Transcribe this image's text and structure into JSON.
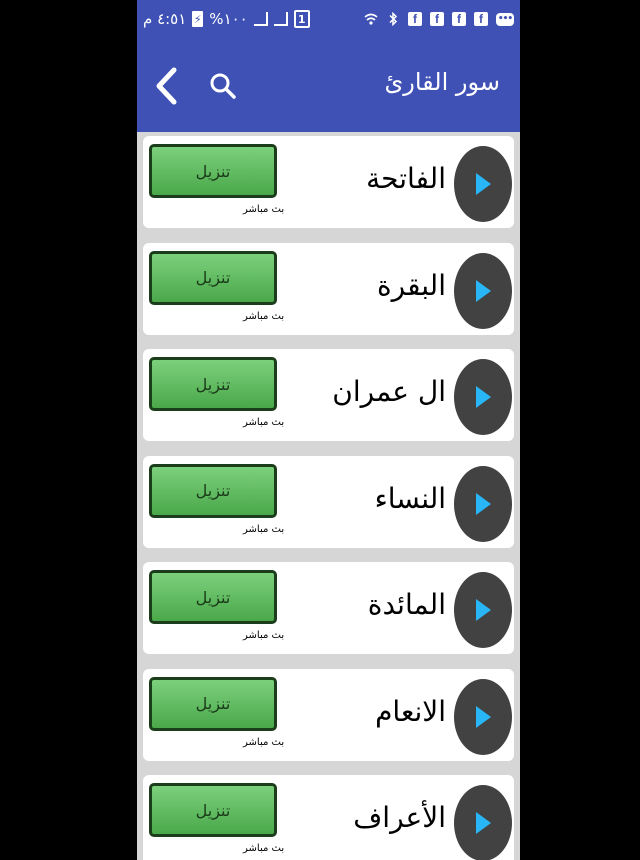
{
  "status_bar": {
    "time": "٤:٥١ م",
    "battery": "%١٠٠",
    "sim_label": "1"
  },
  "app_bar": {
    "title": "سور القارئ"
  },
  "colors": {
    "primary": "#3f51b5",
    "play_icon": "#29b6f6",
    "download_green": "#5cb85c",
    "play_circle": "#424242"
  },
  "surahs": [
    {
      "name": "الفاتحة",
      "download_label": "تنزيل",
      "live_label": "بث مباشر"
    },
    {
      "name": "البقرة",
      "download_label": "تنزيل",
      "live_label": "بث مباشر"
    },
    {
      "name": "ال عمران",
      "download_label": "تنزيل",
      "live_label": "بث مباشر"
    },
    {
      "name": "النساء",
      "download_label": "تنزيل",
      "live_label": "بث مباشر"
    },
    {
      "name": "المائدة",
      "download_label": "تنزيل",
      "live_label": "بث مباشر"
    },
    {
      "name": "الانعام",
      "download_label": "تنزيل",
      "live_label": "بث مباشر"
    },
    {
      "name": "الأعراف",
      "download_label": "تنزيل",
      "live_label": "بث مباشر"
    }
  ]
}
